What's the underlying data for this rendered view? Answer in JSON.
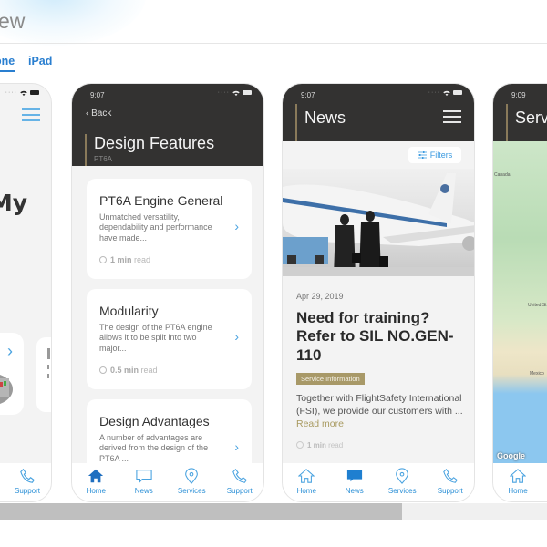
{
  "page": {
    "title": "ew",
    "tabs": [
      {
        "label": "one",
        "active": true
      },
      {
        "label": "iPad",
        "active": false
      }
    ],
    "accent_color": "#2a7fd0"
  },
  "screens": [
    {
      "id": "home",
      "time": "",
      "heading_fragment": "My",
      "tabbar": [
        {
          "label": "Support",
          "icon": "phone-icon"
        }
      ]
    },
    {
      "id": "design-features",
      "time": "9:07",
      "back_label": "Back",
      "title": "Design Features",
      "subtitle": "PT6A",
      "cards": [
        {
          "title": "PT6A Engine General",
          "description": "Unmatched versatility, dependability and performance have made...",
          "read_time": "1 min",
          "read_suffix": "read"
        },
        {
          "title": "Modularity",
          "description": "The design of the PT6A engine allows it to be split into two major...",
          "read_time": "0.5 min",
          "read_suffix": "read"
        },
        {
          "title": "Design Advantages",
          "description": "A number of advantages are derived from the design of the PT6A ...",
          "read_time": "",
          "read_suffix": ""
        }
      ],
      "tabbar": [
        {
          "label": "Home",
          "icon": "home-icon",
          "active": true
        },
        {
          "label": "News",
          "icon": "chat-icon",
          "active": false
        },
        {
          "label": "Services",
          "icon": "location-pin-icon",
          "active": false
        },
        {
          "label": "Support",
          "icon": "phone-icon",
          "active": false
        }
      ]
    },
    {
      "id": "news",
      "time": "9:07",
      "title": "News",
      "filters_label": "Filters",
      "article": {
        "date": "Apr 29, 2019",
        "headline": "Need for training? Refer to SIL NO.GEN-110",
        "badge": "Service Information",
        "body": "Together with FlightSafety International (FSI), we provide our customers with ...",
        "read_more": "Read more",
        "read_time": "1 min",
        "read_suffix": "read"
      },
      "tabbar": [
        {
          "label": "Home",
          "icon": "home-icon",
          "active": false
        },
        {
          "label": "News",
          "icon": "chat-icon",
          "active": true
        },
        {
          "label": "Services",
          "icon": "location-pin-icon",
          "active": false
        },
        {
          "label": "Support",
          "icon": "phone-icon",
          "active": false
        }
      ]
    },
    {
      "id": "services",
      "time": "9:09",
      "title": "Serv",
      "map_labels": [
        "Canada",
        "United St",
        "Mexico"
      ],
      "map_attribution": "Google",
      "tabbar": [
        {
          "label": "Home",
          "icon": "home-icon"
        }
      ]
    }
  ],
  "scrollbar": {
    "position_fraction": 0.0,
    "visible_fraction": 0.735
  }
}
